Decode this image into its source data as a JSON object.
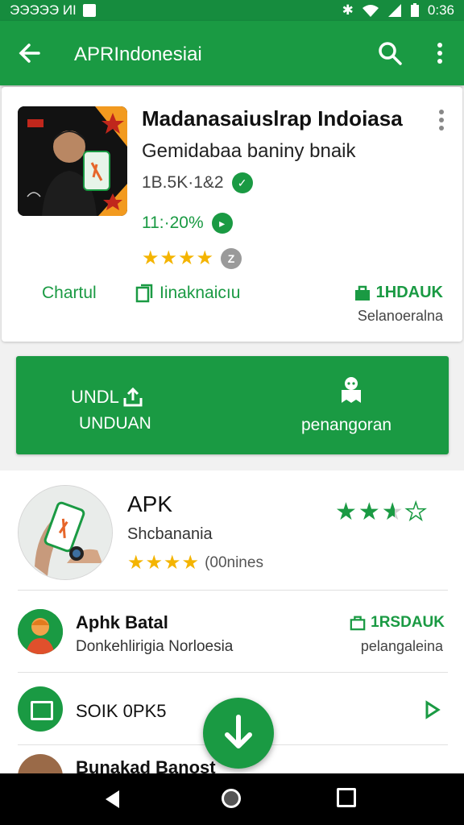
{
  "statusbar": {
    "left_text": "ЭЭЭЭЭ ИI",
    "time": "0:36"
  },
  "appbar": {
    "title": "APRIndonesiai"
  },
  "card": {
    "title": "Madanasaiuslrap Indoiasa",
    "subtitle": "Gemidabaa baniny bnaik",
    "meta1": "1B.5K·1&2",
    "meta2": "11:·20%",
    "rating_badge": "Z",
    "action1": "Chartul",
    "action2": "Iinaknaicıu",
    "action3": "1HDAUK",
    "action3_sub": "Selanoeralna"
  },
  "banner": {
    "left_line1": "UNDL",
    "left_line2": "UNDUAN",
    "right_line": "penangoran"
  },
  "list": {
    "row1": {
      "name": "APK",
      "category": "Shcbanania",
      "rating_text": "(00nines",
      "stars_filled": 3.5
    },
    "row2": {
      "name": "Aphk Batal",
      "sub": "Donkehlirigia Norloesia",
      "right_title": "1RSDAUK",
      "right_sub": "pelangaleina"
    },
    "row3": {
      "name": "SOIK 0PK5"
    },
    "row4": {
      "name": "Bunakad Banost"
    }
  },
  "colors": {
    "brand_green": "#1a9a43",
    "star_yellow": "#f4b400"
  }
}
